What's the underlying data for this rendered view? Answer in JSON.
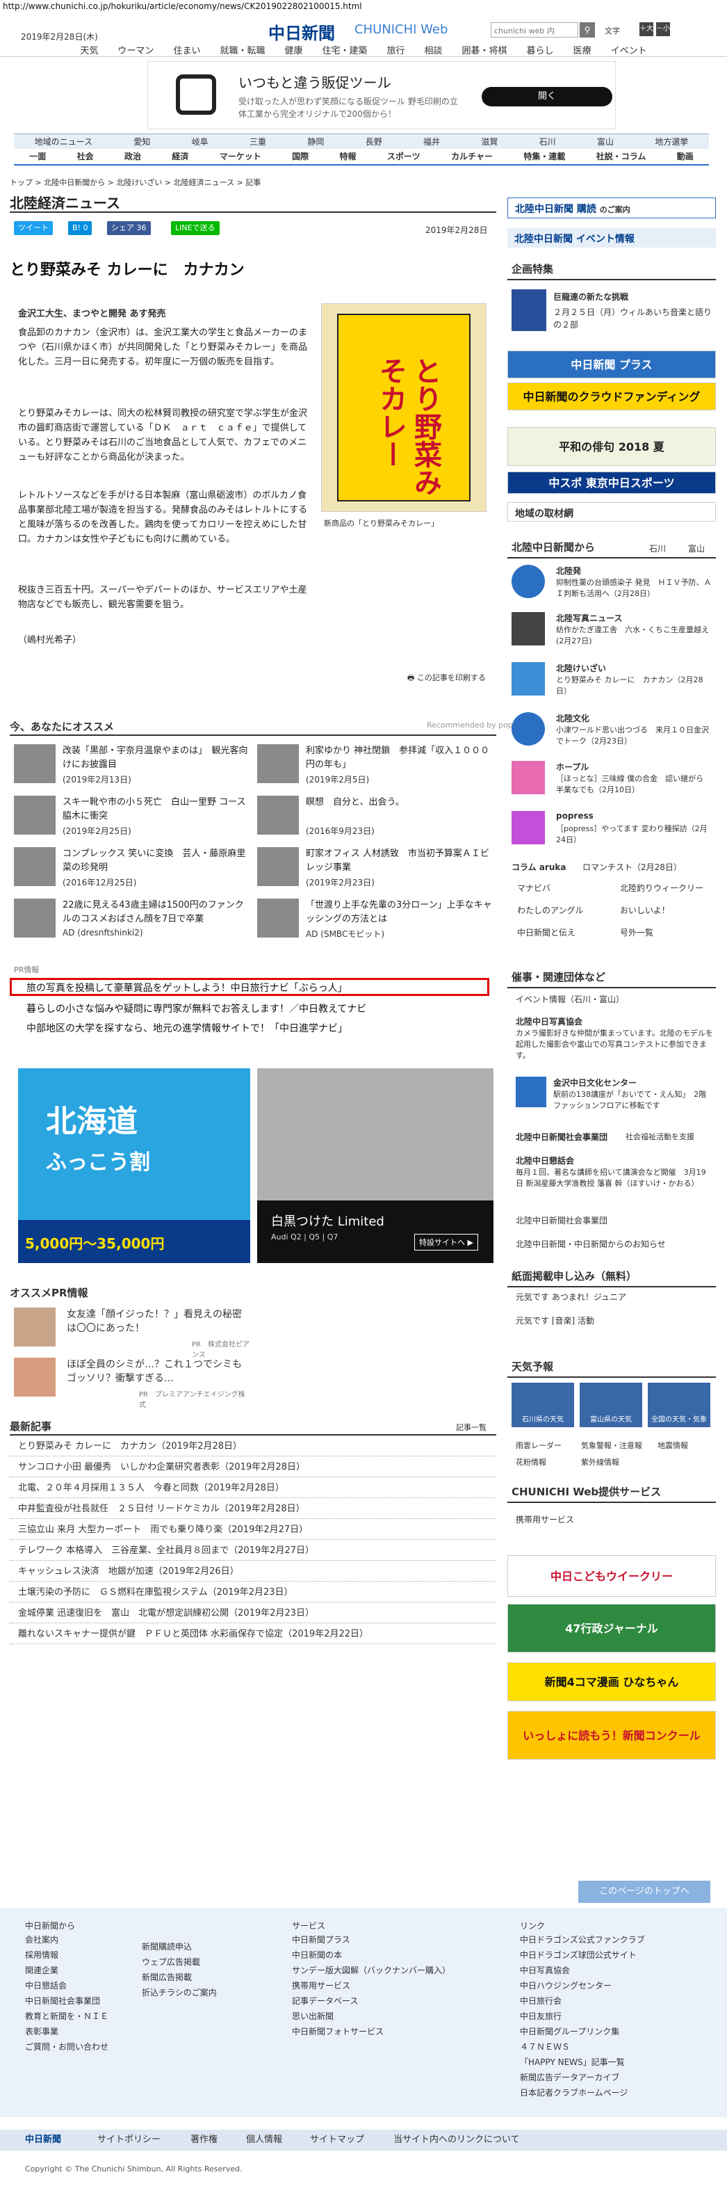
{
  "url": "http://www.chunichi.co.jp/hokuriku/article/economy/news/CK2019022802100015.html",
  "header": {
    "date": "2019年2月28日(木)",
    "logo": "中日新聞",
    "logo_en": "CHUNICHI Web",
    "search_placeholder": "chunichi web 内",
    "text_size_label": "文字",
    "size_large": "＋大",
    "size_small": "－小",
    "nav": [
      "天気",
      "ウーマン",
      "住まい",
      "就職・転職",
      "健康",
      "住宅・建築",
      "旅行",
      "相談",
      "囲碁・将棋",
      "暮らし",
      "医療",
      "イベント"
    ]
  },
  "top_ad": {
    "title": "いつもと違う販促ツール",
    "subtitle": "受け取った人が思わず笑顔になる販促ツール 野毛印刷の立体工業から完全オリジナルで200個から！",
    "button": "開く"
  },
  "region_nav": [
    "地域のニュース",
    "愛知",
    "岐阜",
    "三重",
    "静岡",
    "長野",
    "福井",
    "滋賀",
    "石川",
    "富山",
    "地方選挙"
  ],
  "category_nav": [
    "一面",
    "社会",
    "政治",
    "経済",
    "マーケット",
    "国際",
    "特報",
    "スポーツ",
    "カルチャー",
    "特集・連載",
    "社説・コラム",
    "動画"
  ],
  "breadcrumb": "トップ > 北陸中日新聞から > 北陸けいざい > 北陸経済ニュース > 記事",
  "section_title": "北陸経済ニュース",
  "share": {
    "tweet": "ツイート",
    "hatena": "B! 0",
    "facebook": "シェア 36",
    "line": "LINEで送る"
  },
  "article": {
    "date": "2019年2月28日",
    "title": "とり野菜みそ カレーに　カナカン",
    "byline": "金沢工大生、まつやと開発 あす発売",
    "paragraphs": [
      "食品卸のカナカン（金沢市）は、金沢工業大の学生と食品メーカーのまつや（石川県かほく市）が共同開発した「とり野菜みそカレー」を商品化した。三月一日に発売する。初年度に一万個の販売を目指す。",
      "とり野菜みそカレーは、同大の松林賢司教授の研究室で学ぶ学生が金沢市の醤町商店街で運営している「ＤＫ　ａｒｔ　ｃａｆｅ」で提供している。とり野菜みそは石川のご当地食品として人気で、カフェでのメニューも好評なことから商品化が決まった。",
      "レトルトソースなどを手がける日本製麻（富山県砺波市）のボルカノ食品事業部北陸工場が製造を担当する。発酵食品のみそはレトルトにすると風味が落ちるのを改善した。鶏肉を使ってカロリーを控えめにした甘口。カナカンは女性や子どもにも向けに薦めている。",
      "税抜き三百五十円。スーパーやデパートのほか、サービスエリアや土産物店などでも販売し、観光客需要を狙う。",
      "（嶋村光希子）"
    ],
    "photo_text": "とり野菜みそカレー",
    "photo_caption": "新商品の「とり野菜みそカレー」",
    "print_link": "この記事を印刷する"
  },
  "recommend": {
    "title": "今、あなたにオススメ",
    "powered": "Recommended by popIn",
    "items": [
      {
        "text": "改装「黒部・宇奈月温泉やまのは」　観光客向けにお披露目",
        "date": "(2019年2月13日)"
      },
      {
        "text": "利家ゆかり 神社閉鎖　参拝減「収入１０００円の年も」",
        "date": "(2019年2月5日)"
      },
      {
        "text": "スキー靴や市の小５死亡　白山一里野 コース脇木に衝突",
        "date": "(2019年2月25日)"
      },
      {
        "text": "瞑想　自分と、出会う。",
        "date": "(2016年9月23日)"
      },
      {
        "text": "コンプレックス 笑いに変換　芸人・藤原麻里菜の珍発明",
        "date": "(2016年12月25日)"
      },
      {
        "text": "町家オフィス 人材誘致　市当初予算案ＡＩビレッジ事業",
        "date": "(2019年2月23日)"
      },
      {
        "text": "22歳に見える43歳主婦は1500円のファンクルのコスメおばさん顔を7日で卒業",
        "date": "AD (dresnftshinki2)"
      },
      {
        "text": "「世渡り上手な先輩の3分ローン」上手なキャッシングの方法とは",
        "date": "AD (SMBCモビット)"
      }
    ]
  },
  "pr": {
    "label": "PR情報",
    "lines": [
      "旅の写真を投稿して豪華賞品をゲットしよう！中日旅行ナビ「ぶらっ人」",
      "暮らしの小さな悩みや疑問に専門家が無料でお答えします！／中日教えてナビ",
      "中部地区の大学を探すなら、地元の進学情報サイトで！「中日進学ナビ」"
    ]
  },
  "ads": {
    "hokkaido_title": "北海道",
    "hokkaido_sub": "ふっこう割",
    "hokkaido_price": "5,000円〜35,000円",
    "audi_title": "白黒つけた Limited",
    "audi_sub": "Audi Q2 | Q5 | Q7",
    "audi_btn": "特設サイトへ ▶"
  },
  "osusume_pr": {
    "title": "オススメPR情報",
    "items": [
      {
        "text": "女友達「顔イジった！？」看見えの秘密は〇〇にあった！",
        "src": "PR　株式会社ピアンス"
      },
      {
        "text": "ほぼ全員のシミが…？これ１つでシミもゴッソリ？衝撃すぎる…",
        "src": "PR　プレミアアンチエイジング株式"
      }
    ]
  },
  "latest": {
    "title": "最新記事",
    "more": "記事一覧",
    "items": [
      "とり野菜みそ カレーに　カナカン（2019年2月28日）",
      "サンコロナ小田 最優秀　いしかわ企業研究者表彰（2019年2月28日）",
      "北電、２０年４月採用１３５人　今春と同数（2019年2月28日）",
      "中井監査役が社長就任　２５日付 リードケミカル（2019年2月28日）",
      "三協立山 来月 大型カーポート　雨でも乗り降り楽（2019年2月27日）",
      "テレワーク 本格導入　三谷産業、全社員月８回まで（2019年2月27日）",
      "キャッシュレス決済　地銀が加速（2019年2月26日）",
      "土壌汚染の予防に　ＧＳ燃料在庫監視システム（2019年2月23日）",
      "金城停業 迅速復旧を　富山　北電が想定訓練初公開（2019年2月23日）",
      "離れないスキャナー提供が鍵　ＰＦＵと英団体 水彩画保存で協定（2019年2月22日）"
    ]
  },
  "sidebar": {
    "subscribe": "北陸中日新聞 購読",
    "subscribe_link": "のご案内",
    "event": "北陸中日新聞 イベント情報",
    "kikaku_title": "企画特集",
    "kikaku_item_title": "巨龍連の新たな挑戦",
    "kikaku_item_text": "２月２５日（月）ウィルあいち音楽と語りの２部",
    "banners": [
      "中日新聞 プラス",
      "中日新聞のクラウドファンディング",
      "平和の俳句 2018 夏",
      "中スポ 東京中日スポーツ"
    ],
    "local_title": "地域の取材網",
    "hokuriku_title": "北陸中日新聞から",
    "hokuriku_links": [
      "石川",
      "富山"
    ],
    "hokuriku_items": [
      {
        "label": "北陸発",
        "text": "抑制性薬の台頭感染子 発見　ＨＩＶ予防、ＡＩ判断も活用へ（2月28日）"
      },
      {
        "label": "北陸写真ニュース",
        "text": "紡作かたぎ違工舎　六水・くちこ生産量越え(2月27日)"
      },
      {
        "label": "北陸けいざい",
        "text": "とり野菜みそ カレーに　カナカン（2月28日）"
      },
      {
        "label": "北陸文化",
        "text": "小津ワールド思い出つづる　来月１０日金沢でトーク（2月23日）"
      },
      {
        "label": "ホープル",
        "text": "［ほっとな］三味線 僕の合金　認い継がら 半業なでも（2月10日）"
      },
      {
        "label": "popress",
        "text": "［popress］やってます 変わり種探訪（2月24日）"
      }
    ],
    "column_label": "コラム aruka",
    "column_sub": "ロマンチスト（2月28日）",
    "small_links": [
      "マナビバ",
      "北陸釣りウィークリー",
      "わたしのアングル",
      "おいしいよ！",
      "中日新聞と伝え",
      "号外一覧"
    ],
    "dept_title": "催事・関連団体など",
    "event_label": "イベント情報（石川・富山）",
    "dept_items": [
      {
        "label": "北陸中日写真協会",
        "text": "カメラ撮影好きな仲間が集まっています。北陸のモデルを起用した撮影会や富山での写真コンテストに参加できます。"
      },
      {
        "label": "金沢中日文化センター",
        "text": "駅前の138講座が「おいでて・えん知」　2階ファッションフロアに移転です"
      },
      {
        "label": "北陸中日新聞社会事業団",
        "text": "社会福祉活動を支援"
      },
      {
        "label": "北陸中日懇話会",
        "text": "毎月１回、著名な講師を招いて講演会など開催　3月19日 新潟星藤大学准教授 藩喜 幹（ほすいけ・かおる）"
      },
      {
        "label": "北陸中日新聞社会事業団",
        "text": ""
      },
      {
        "label": "北陸中日新聞・中日新聞からのお知らせ",
        "text": ""
      }
    ],
    "shimen_title": "紙面掲載申し込み（無料）",
    "shimen_items": [
      "元気です あつまれ！ジュニア",
      "元気です [音楽] 活動"
    ],
    "weather_title": "天気予報",
    "weather_cells": [
      "石川県の天気",
      "富山県の天気",
      "全国の天気・気象"
    ],
    "weather_links": [
      "雨雲レーダー",
      "気象警報・注意報",
      "地震情報",
      "花粉情報",
      "紫外線情報"
    ],
    "web_title": "CHUNICHI Web提供サービス",
    "web_item": "携帯用サービス",
    "promo": [
      "中日こどもウイークリー",
      "47行政ジャーナル",
      "新聞4コマ漫画 ひなちゃん",
      "いっしょに読もう！新聞コンクール"
    ]
  },
  "to_top": "このページのトップへ",
  "footer": {
    "col1_title": "中日新聞から",
    "col1": [
      "会社案内",
      "採用情報",
      "関連企業",
      "中日懇話会",
      "中日新聞社会事業団",
      "教育と新聞を・ＮＩＥ",
      "表彰事業",
      "ご質問・お問い合わせ"
    ],
    "col2": [
      "新聞購読申込",
      "ウェブ広告掲載",
      "新聞広告掲載",
      "折込チラシのご案内"
    ],
    "col3_title": "サービス",
    "col3": [
      "中日新聞プラス",
      "中日新聞の本",
      "サンデー版大図解（バックナンバー購入）",
      "携帯用サービス",
      "記事データベース",
      "思い出新聞",
      "中日新聞フォトサービス"
    ],
    "col4_title": "リンク",
    "col4": [
      "中日ドラゴンズ公式ファンクラブ",
      "中日ドラゴンズ球団公式サイト",
      "中日写真協会",
      "中日ハウジングセンター",
      "中日旅行会",
      "中日友旅行",
      "中日新聞グループリンク集",
      "４７ＮＥＷＳ",
      "「HAPPY NEWS」記事一覧",
      "新聞広告データアーカイブ",
      "日本記者クラブホームページ"
    ],
    "bottom_logo": "中日新聞",
    "bottom_links": [
      "サイトポリシー",
      "著作権",
      "個人情報",
      "サイトマップ",
      "当サイト内へのリンクについて"
    ],
    "copyright": "Copyright © The Chunichi Shimbun, All Rights Reserved."
  },
  "colors": {
    "brand": "#003f8e",
    "accent": "#2b6fc2",
    "pr_border": "#e00000",
    "twitter": "#1da1f2",
    "facebook": "#3b5998",
    "line": "#00b900",
    "hatena": "#008fde"
  }
}
